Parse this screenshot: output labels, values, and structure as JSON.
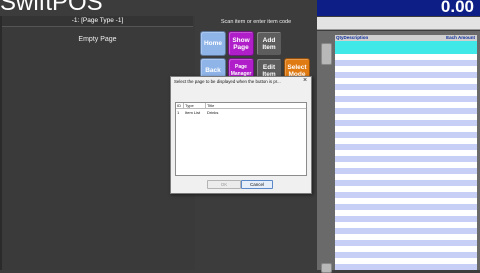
{
  "app": {
    "title": "SwiftPOS",
    "total": "0.00"
  },
  "page_panel": {
    "page_type": "-1:  [Page Type -1]",
    "empty_label": "Empty Page"
  },
  "scan": {
    "hint": "Scan item or enter item code"
  },
  "buttons": {
    "home": "Home",
    "show_page": "Show Page",
    "add_item": "Add Item",
    "back": "Back",
    "page_manager": "Page Manager",
    "edit_item": "Edit Item",
    "select_mode": "Select Mode"
  },
  "order": {
    "columns": {
      "qty": "Qty",
      "description": "Description",
      "amount": "Each Amount"
    }
  },
  "modal": {
    "title": "Select the page to be displayed when the button is pr...",
    "close": "×",
    "columns": {
      "id": "ID",
      "type": "Type",
      "title": "Title"
    },
    "rows": [
      {
        "id": "1",
        "type": "Item List",
        "title": "Drinks"
      }
    ],
    "ok_label": "OK",
    "cancel_label": "Cancel"
  },
  "colors": {
    "accent_blue": "#0d1f86",
    "purple": "#b01ec9",
    "orange": "#e07a12",
    "cyan": "#40e8e8"
  }
}
